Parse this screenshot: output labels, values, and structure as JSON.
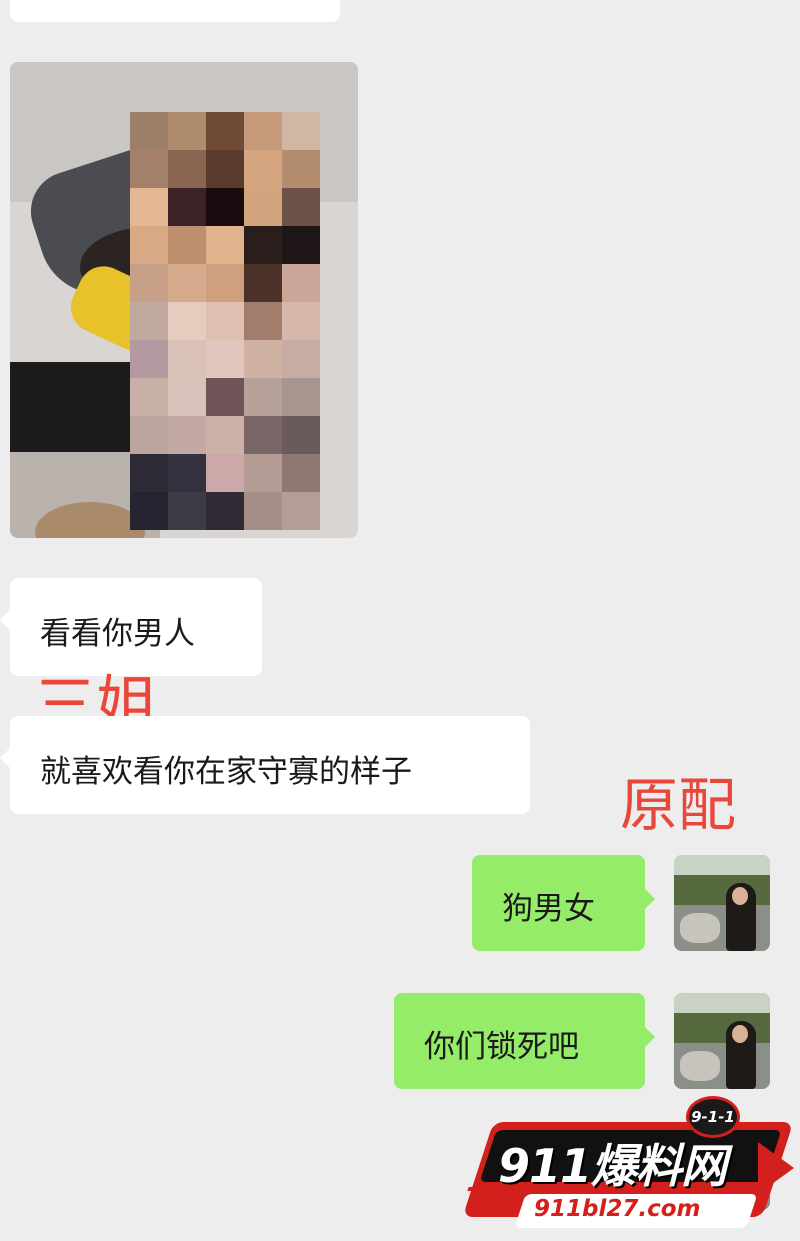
{
  "messages": {
    "left": [
      {
        "text": "看看你男人"
      },
      {
        "text": "就喜欢看你在家守寡的样子"
      }
    ],
    "right": [
      {
        "text": "狗男女"
      },
      {
        "text": "你们锁死吧"
      }
    ]
  },
  "annotations": {
    "left_label": "三姐",
    "right_label": "原配"
  },
  "watermark": {
    "badge": "9-1-1",
    "brand": "911爆料网",
    "url": "911bl27.com"
  },
  "colors": {
    "background": "#ededed",
    "received_bubble": "#ffffff",
    "sent_bubble": "#95ec69",
    "annotation": "#e8473a",
    "logo_red": "#d3201c"
  }
}
